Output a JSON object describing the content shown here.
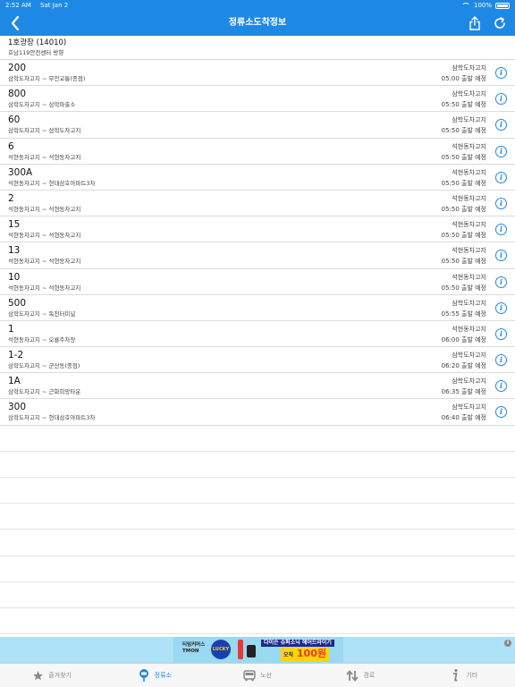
{
  "status": {
    "time": "2:52 AM",
    "date": "Sat Jan 2",
    "battery": "100%"
  },
  "nav": {
    "title": "정류소도착정보"
  },
  "stop": {
    "name": "1호광장 (14010)",
    "direction": "호남119안전센터 방향"
  },
  "rows": [
    {
      "number": "200",
      "route": "삼학도차고지 ~ 무안교통(종점)",
      "dest": "삼학도차고지",
      "time": "05:00 출발 예정"
    },
    {
      "number": "800",
      "route": "삼학도차고지 ~ 삼학파출소",
      "dest": "삼학도차고지",
      "time": "05:50 출발 예정"
    },
    {
      "number": "60",
      "route": "삼학도차고지 ~ 삼학도차고지",
      "dest": "삼학도차고지",
      "time": "05:50 출발 예정"
    },
    {
      "number": "6",
      "route": "석현동차고지 ~ 석현동차고지",
      "dest": "석현동차고지",
      "time": "05:50 출발 예정"
    },
    {
      "number": "300A",
      "route": "석현동차고지 ~ 현대삼호아파트3차",
      "dest": "석현동차고지",
      "time": "05:50 출발 예정"
    },
    {
      "number": "2",
      "route": "석현동차고지 ~ 석현동차고지",
      "dest": "석현동차고지",
      "time": "05:50 출발 예정"
    },
    {
      "number": "15",
      "route": "석현동차고지 ~ 석현동차고지",
      "dest": "석현동차고지",
      "time": "05:50 출발 예정"
    },
    {
      "number": "13",
      "route": "석현동차고지 ~ 석현동차고지",
      "dest": "석현동차고지",
      "time": "05:50 출발 예정"
    },
    {
      "number": "10",
      "route": "석현동차고지 ~ 석현동차고지",
      "dest": "석현동차고지",
      "time": "05:50 출발 예정"
    },
    {
      "number": "500",
      "route": "삼학도차고지 ~ 독천터미널",
      "dest": "삼학도차고지",
      "time": "05:55 출발 예정"
    },
    {
      "number": "1",
      "route": "석현동차고지 ~ 오룡주차장",
      "dest": "석현동차고지",
      "time": "06:00 출발 예정"
    },
    {
      "number": "1-2",
      "route": "삼학도차고지 ~ 군산동(종점)",
      "dest": "삼학도차고지",
      "time": "06:20 출발 예정"
    },
    {
      "number": "1A",
      "route": "삼학도차고지 ~ 근화희망타운",
      "dest": "삼학도차고지",
      "time": "06:35 출발 예정"
    },
    {
      "number": "300",
      "route": "삼학도차고지 ~ 현대삼호아파트3차",
      "dest": "삼학도차고지",
      "time": "06:40 출발 예정"
    }
  ],
  "ad": {
    "brand_line1": "티임커머스",
    "brand_line2": "TMON",
    "badge": "LUCKY",
    "headline": "다이슨 슈퍼소닉 헤어드라이기",
    "prize": "100원",
    "prize_prefix": "오직"
  },
  "tabs": [
    {
      "label": "즐겨찾기",
      "icon": "star-icon"
    },
    {
      "label": "정류소",
      "icon": "bus-stop-icon"
    },
    {
      "label": "노선",
      "icon": "bus-icon"
    },
    {
      "label": "경로",
      "icon": "route-arrows-icon"
    },
    {
      "label": "기타",
      "icon": "info-icon"
    }
  ],
  "colors": {
    "accent": "#1e88e5",
    "inactive": "#8a8a8a"
  }
}
